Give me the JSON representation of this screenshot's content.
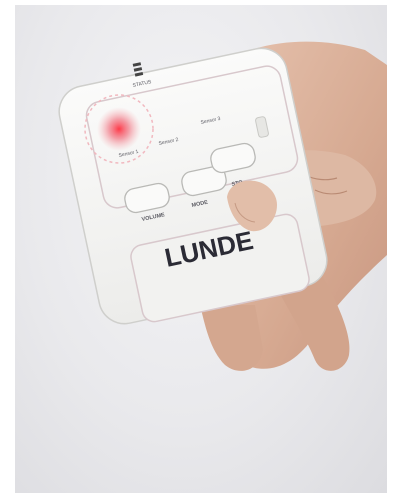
{
  "device": {
    "status_label": "STATUS",
    "sensor1_label": "Sensor 1",
    "sensor2_label": "Sensor 2",
    "sensor3_label": "Sensor 3",
    "volume_label": "VOLUME",
    "mode_label": "MODE",
    "stop_label": "STO",
    "brand": "LUNDE",
    "colors": {
      "body": "#f7f7f5",
      "outline": "#d9c9cd",
      "led": "#e8232f",
      "skin": "#d9b29c"
    }
  }
}
